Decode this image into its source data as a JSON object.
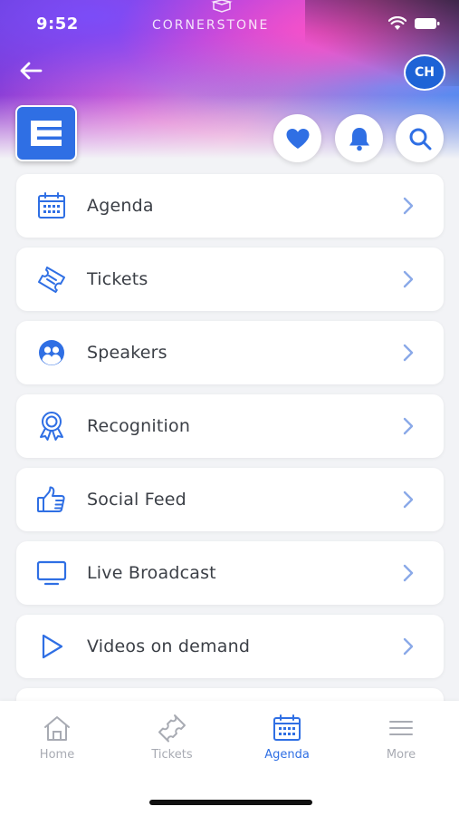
{
  "status": {
    "time": "9:52",
    "brand": "CORNERSTONE"
  },
  "header": {
    "avatar_initials": "CH"
  },
  "menu": [
    {
      "label": "Agenda",
      "icon": "calendar-icon"
    },
    {
      "label": "Tickets",
      "icon": "ticket-icon"
    },
    {
      "label": "Speakers",
      "icon": "speakers-icon"
    },
    {
      "label": "Recognition",
      "icon": "award-icon"
    },
    {
      "label": "Social Feed",
      "icon": "thumbs-up-icon"
    },
    {
      "label": "Live Broadcast",
      "icon": "monitor-icon"
    },
    {
      "label": "Videos on demand",
      "icon": "play-icon"
    }
  ],
  "tabs": [
    {
      "label": "Home",
      "icon": "home-icon",
      "active": false
    },
    {
      "label": "Tickets",
      "icon": "ticket-icon",
      "active": false
    },
    {
      "label": "Agenda",
      "icon": "calendar-icon",
      "active": true
    },
    {
      "label": "More",
      "icon": "menu-icon",
      "active": false
    }
  ],
  "colors": {
    "accent": "#2f6fe4",
    "inactive": "#a8abb3",
    "text": "#3b3f46"
  }
}
